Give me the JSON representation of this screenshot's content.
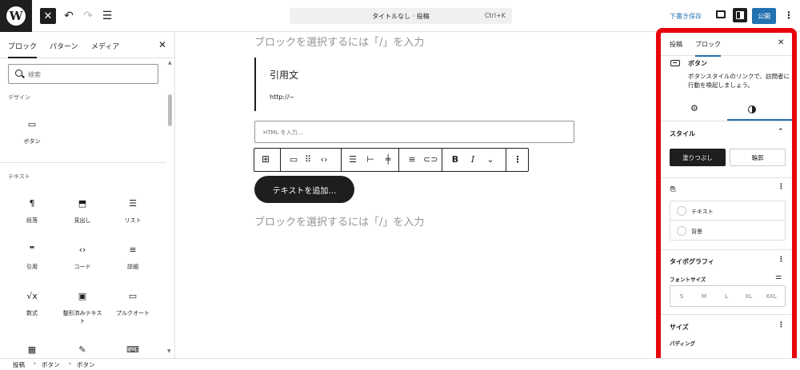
{
  "topbar": {
    "wp_logo": "W",
    "command_title": "タイトルなし · 投稿",
    "command_shortcut": "Ctrl+K",
    "save_draft": "下書き保存",
    "publish": "公開"
  },
  "inserter": {
    "tabs": [
      "ブロック",
      "パターン",
      "メディア"
    ],
    "search_placeholder": "検索",
    "category_design": "デザイン",
    "category_text": "テキスト",
    "blocks": [
      {
        "icon": "button-icon",
        "label": "ボタン"
      },
      {
        "icon": "paragraph-icon",
        "label": "段落"
      },
      {
        "icon": "bookmark-icon",
        "label": "見出し"
      },
      {
        "icon": "list-icon",
        "label": "リスト"
      },
      {
        "icon": "quote-icon",
        "label": "引用"
      },
      {
        "icon": "code-icon",
        "label": "コード"
      },
      {
        "icon": "details-icon",
        "label": "詳細"
      },
      {
        "icon": "math-icon",
        "label": "数式"
      },
      {
        "icon": "preformatted-icon",
        "label": "整形済みテキスト"
      },
      {
        "icon": "pullquote-icon",
        "label": "プルクオート"
      }
    ]
  },
  "canvas": {
    "placeholder_top": "ブロックを選択するには「/」を入力",
    "quote_text": "引用文",
    "quote_cite": "http://~",
    "html_placeholder": "HTML を入力…",
    "button_text": "テキストを追加…",
    "placeholder_bottom": "ブロックを選択するには「/」を入力"
  },
  "sidebar": {
    "tabs": [
      "投稿",
      "ブロック"
    ],
    "block_name": "ボタン",
    "block_desc": "ボタンスタイルのリンクで、訪問者に行動を喚起しましょう。",
    "styles_title": "スタイル",
    "style_fill": "塗りつぶし",
    "style_outline": "輪郭",
    "color_title": "色",
    "color_text": "テキスト",
    "color_background": "背景",
    "typography_title": "タイポグラフィ",
    "font_size_label": "フォントサイズ",
    "sizes": [
      "S",
      "M",
      "L",
      "XL",
      "XXL"
    ],
    "size_title": "サイズ",
    "padding_label": "パディング",
    "highlight_color": "#e8000b"
  },
  "footer": {
    "breadcrumbs": [
      "投稿",
      "ボタン",
      "ボタン"
    ]
  }
}
